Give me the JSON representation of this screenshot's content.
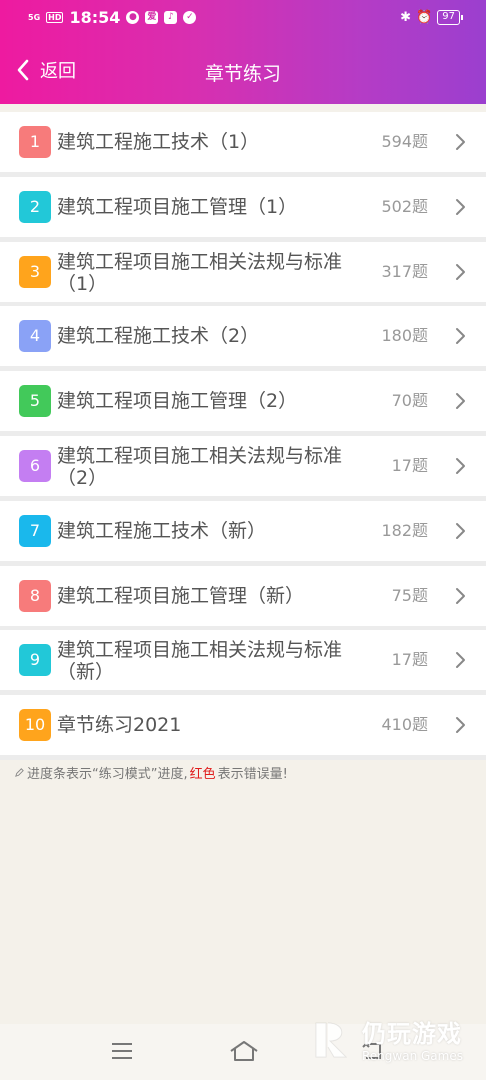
{
  "status_bar": {
    "network": "5G",
    "hd": "HD",
    "time": "18:54",
    "battery": "97"
  },
  "nav": {
    "back_label": "返回",
    "title": "章节练习"
  },
  "chapters": [
    {
      "num": "1",
      "title": "建筑工程施工技术（1）",
      "count": "594题",
      "color": "#f77b7b"
    },
    {
      "num": "2",
      "title": "建筑工程项目施工管理（1）",
      "count": "502题",
      "color": "#22c8d8"
    },
    {
      "num": "3",
      "title": "建筑工程项目施工相关法规与标准（1）",
      "count": "317题",
      "color": "#ffa41c"
    },
    {
      "num": "4",
      "title": "建筑工程施工技术（2）",
      "count": "180题",
      "color": "#8aa2f6"
    },
    {
      "num": "5",
      "title": "建筑工程项目施工管理（2）",
      "count": "70题",
      "color": "#42c95a"
    },
    {
      "num": "6",
      "title": "建筑工程项目施工相关法规与标准（2）",
      "count": "17题",
      "color": "#c47ef2"
    },
    {
      "num": "7",
      "title": "建筑工程施工技术（新）",
      "count": "182题",
      "color": "#1ab8ec"
    },
    {
      "num": "8",
      "title": "建筑工程项目施工管理（新）",
      "count": "75题",
      "color": "#f77b7b"
    },
    {
      "num": "9",
      "title": "建筑工程项目施工相关法规与标准（新）",
      "count": "17题",
      "color": "#22c8d8"
    },
    {
      "num": "10",
      "title": "章节练习2021",
      "count": "410题",
      "color": "#ffa41c"
    }
  ],
  "note": {
    "prefix": "进度条表示“练习模式”进度,",
    "red": "红色",
    "suffix": "表示错误量!"
  },
  "watermark": {
    "cn": "仍玩游戏",
    "en": "Rengwan Games"
  },
  "colors": {
    "header_start": "#ee1aa0",
    "header_end": "#9b3fcf",
    "error_red": "#e01c1c"
  }
}
